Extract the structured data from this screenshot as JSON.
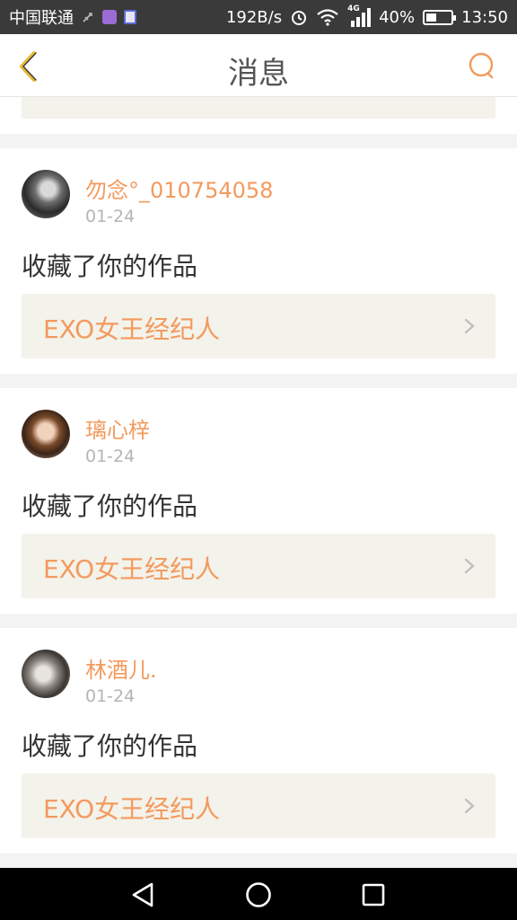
{
  "status_bar": {
    "carrier": "中国联通",
    "speed": "192B/s",
    "network": "4G",
    "battery": "40%",
    "battery_level": 0.4,
    "time": "13:50"
  },
  "nav": {
    "title": "消息"
  },
  "messages": [
    {
      "username": "勿念°_010754058",
      "date": "01-24",
      "action": "收藏了你的作品",
      "work_title": "EXO女王经纪人"
    },
    {
      "username": "璃心梓",
      "date": "01-24",
      "action": "收藏了你的作品",
      "work_title": "EXO女王经纪人"
    },
    {
      "username": "林酒儿.",
      "date": "01-24",
      "action": "收藏了你的作品",
      "work_title": "EXO女王经纪人"
    }
  ],
  "colors": {
    "accent": "#f39a5d",
    "back_arrow": "#e6b83a"
  },
  "icons": {
    "back": "chevron-left-icon",
    "search": "search-icon",
    "work_arrow": "chevron-right-icon",
    "sys_back": "triangle-back-icon",
    "sys_home": "circle-home-icon",
    "sys_recent": "square-recent-icon"
  }
}
